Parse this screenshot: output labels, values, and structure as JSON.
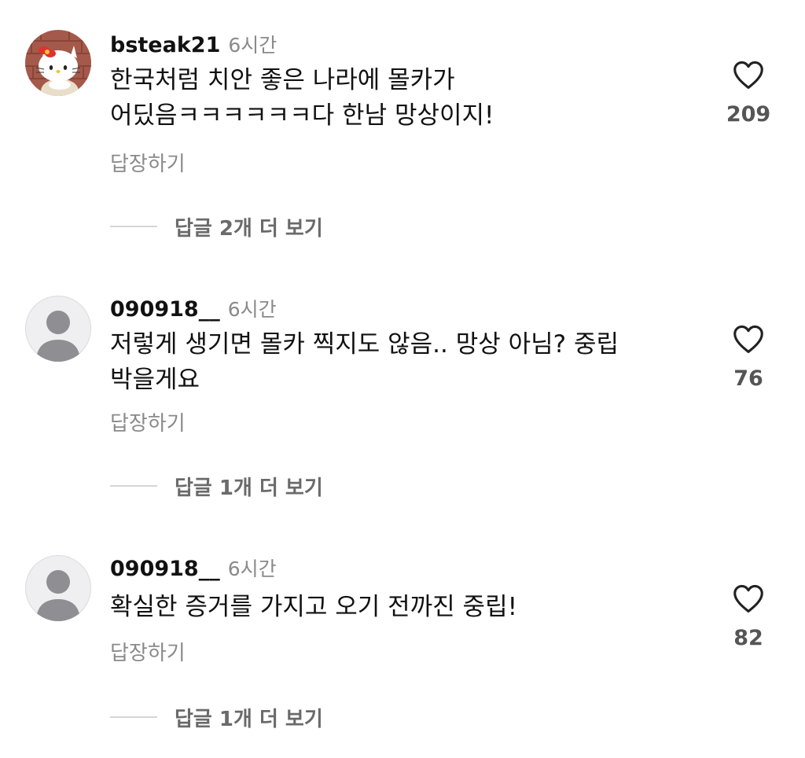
{
  "comments": [
    {
      "username": "bsteak21",
      "time": "6시간",
      "avatar_icon": "hello-kitty-avatar",
      "text": "한국처럼 치안 좋은 나라에 몰카가 어딨음ㅋㅋㅋㅋㅋㅋ다 한남 망상이지!",
      "likes": "209",
      "reply_label": "답장하기",
      "more_replies_label": "답글 2개 더 보기"
    },
    {
      "username": "090918__",
      "time": "6시간",
      "avatar_icon": "default-user-avatar",
      "text": "저렇게 생기면 몰카 찍지도 않음.. 망상 아님? 중립 박을게요",
      "likes": "76",
      "reply_label": "답장하기",
      "more_replies_label": "답글 1개 더 보기"
    },
    {
      "username": "090918__",
      "time": "6시간",
      "avatar_icon": "default-user-avatar",
      "text": "확실한 증거를 가지고 오기 전까진 중립!",
      "likes": "82",
      "reply_label": "답장하기",
      "more_replies_label": "답글 1개 더 보기"
    }
  ],
  "icons": {
    "like": "heart-outline-icon"
  },
  "colors": {
    "text_primary": "#111111",
    "text_secondary": "#8a8a8a",
    "like_count": "#555555",
    "more_replies": "#6a6a6a",
    "avatar_default": "#8e8e93"
  }
}
